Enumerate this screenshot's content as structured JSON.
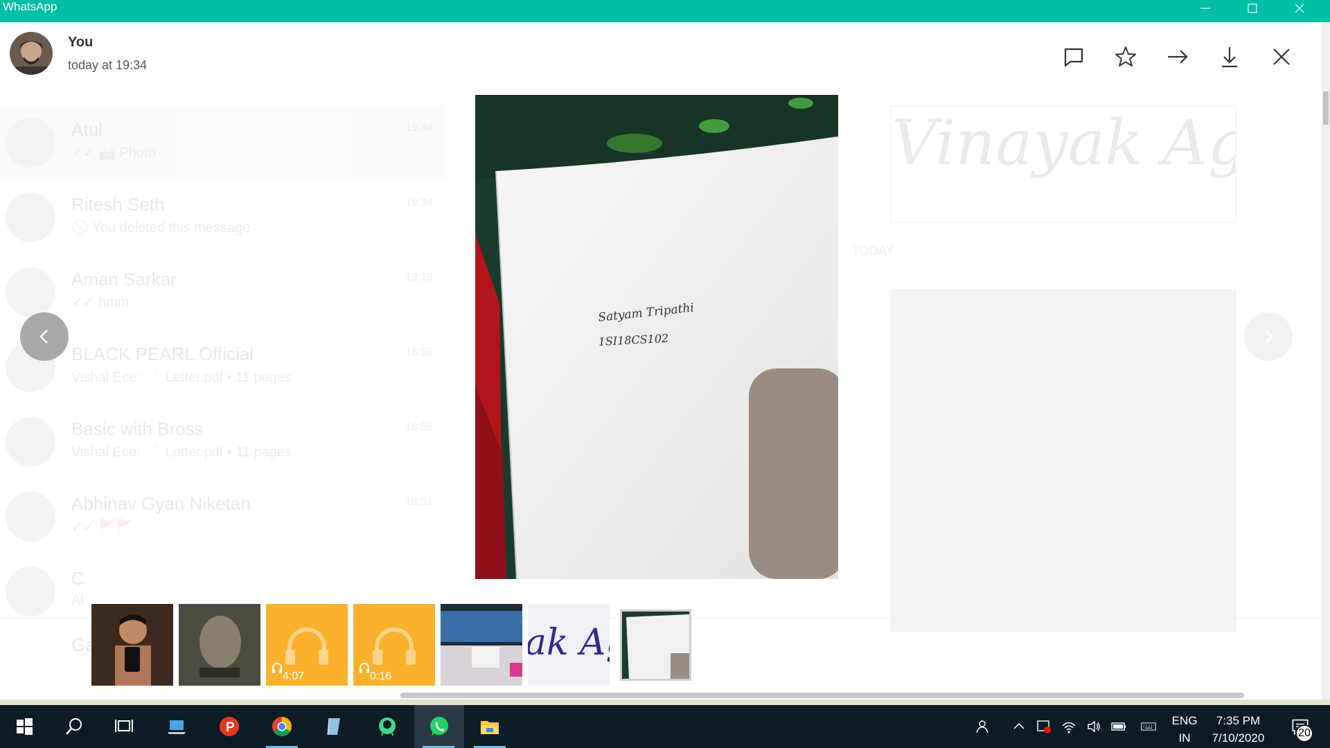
{
  "window": {
    "title": "WhatsApp",
    "accent": "#00bfa5"
  },
  "viewer": {
    "sender": "You",
    "sent_time": "today at 19:34",
    "actions": [
      {
        "name": "reply-icon"
      },
      {
        "name": "star-icon"
      },
      {
        "name": "forward-icon"
      },
      {
        "name": "download-icon"
      },
      {
        "name": "close-icon"
      }
    ],
    "image_text": {
      "line1": "Satyam Tripathi",
      "line2": "1SI18CS102"
    }
  },
  "background_chats": [
    {
      "name": "Atul",
      "message": "✓✓ 📷 Photo",
      "time": "19:34"
    },
    {
      "name": "Ritesh Seth",
      "message": "🚫 You deleted this message",
      "time": "19:34"
    },
    {
      "name": "Aman Sarkar",
      "message": "✓✓ hmm",
      "time": "19:19"
    },
    {
      "name": "BLACK PEARL Official",
      "message": "Vishal Ece: 📄 Letter.pdf • 11 pages",
      "time": "18:56"
    },
    {
      "name": "Basic with Bross",
      "message": "Vishal Ece: 📄 Letter.pdf • 11 pages",
      "time": "18:56"
    },
    {
      "name": "Abhinav Gyan Niketan",
      "message": "✓✓ 🚩🚩",
      "time": "18:51"
    },
    {
      "name": "C",
      "message": "Al",
      "time": ""
    },
    {
      "name": "Gauri",
      "message": "",
      "time": ""
    }
  ],
  "background_conversation": {
    "handwriting": "Vinayak Agarwal",
    "date_divider": "TODAY"
  },
  "thumbnails": [
    {
      "type": "image",
      "name": "thumb-selfie"
    },
    {
      "type": "image",
      "name": "thumb-video"
    },
    {
      "type": "audio",
      "duration": "4:07"
    },
    {
      "type": "audio",
      "duration": "0:16"
    },
    {
      "type": "image",
      "name": "thumb-screen"
    },
    {
      "type": "image",
      "name": "thumb-handwriting",
      "text": "ak Ag"
    },
    {
      "type": "image",
      "name": "thumb-current",
      "selected": true
    }
  ],
  "taskbar": {
    "language": "ENG",
    "region": "IN",
    "time": "7:35 PM",
    "date": "7/10/2020",
    "notifications": "20"
  }
}
